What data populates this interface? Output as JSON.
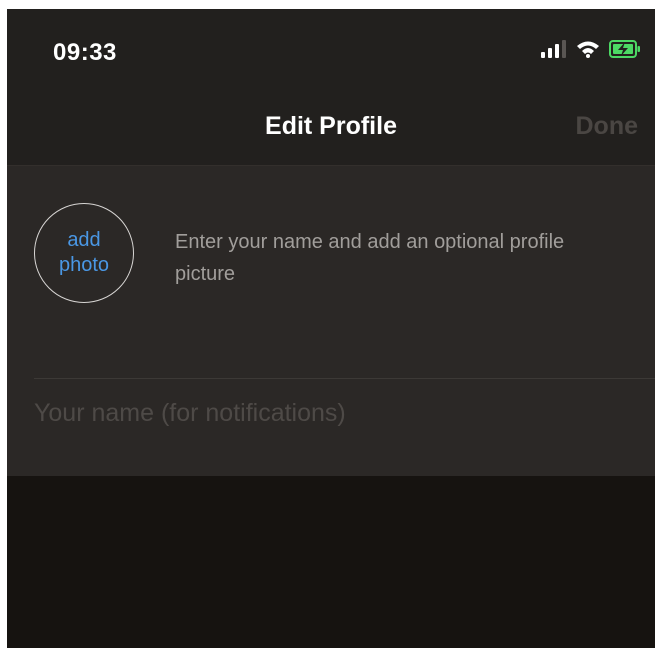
{
  "status_bar": {
    "time": "09:33",
    "icons": [
      "signal-icon",
      "wifi-icon",
      "battery-charging-icon"
    ],
    "battery_color": "#4cd964"
  },
  "nav": {
    "title": "Edit Profile",
    "done_label": "Done"
  },
  "profile": {
    "add_photo_line1": "add",
    "add_photo_line2": "photo",
    "hint": "Enter your name and add an optional profile picture",
    "name_value": "",
    "name_placeholder": "Your name (for notifications)"
  },
  "colors": {
    "accent": "#4a97e4",
    "background": "#161310",
    "bar": "#22201e",
    "panel": "#2b2826"
  }
}
